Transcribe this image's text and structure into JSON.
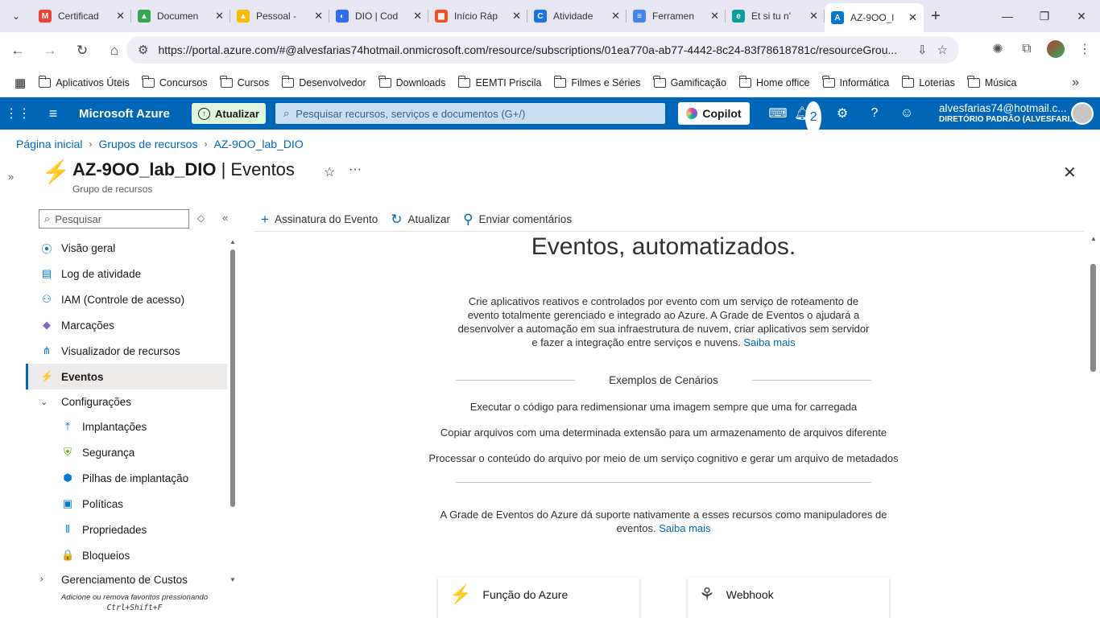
{
  "browser": {
    "tabs": [
      {
        "title": "Certificad",
        "icon": "gmail-icon",
        "color": "#ea4335",
        "glyph": "M"
      },
      {
        "title": "Documen",
        "icon": "google-drive-icon",
        "color": "#34a853",
        "glyph": "▲"
      },
      {
        "title": "Pessoal - ",
        "icon": "google-drive-icon",
        "color": "#fbbc04",
        "glyph": "▲"
      },
      {
        "title": "DIO | Cod",
        "icon": "dio-icon",
        "color": "#2e6ef5",
        "glyph": "◐"
      },
      {
        "title": "Início Ráp",
        "icon": "microsoft-icon",
        "color": "#f25022",
        "glyph": "▦"
      },
      {
        "title": "Atividade",
        "icon": "classroom-icon",
        "color": "#1a73e8",
        "glyph": "C"
      },
      {
        "title": "Ferramen",
        "icon": "docs-icon",
        "color": "#4285f4",
        "glyph": "≡"
      },
      {
        "title": "Et si tu n'",
        "icon": "edge-icon",
        "color": "#0c9e9e",
        "glyph": "e"
      },
      {
        "title": "AZ-9OO_l",
        "icon": "azure-icon",
        "color": "#0078d4",
        "glyph": "A"
      }
    ],
    "url": "https://portal.azure.com/#@alvesfarias74hotmail.onmicrosoft.com/resource/subscriptions/01ea770a-ab77-4442-8c24-83f78618781c/resourceGrou...",
    "bookmarks": [
      "Aplicativos Úteis",
      "Concursos",
      "Cursos",
      "Desenvolvedor",
      "Downloads",
      "EEMTI Priscila",
      "Filmes e Séries",
      "Gamificação",
      "Home office",
      "Informática",
      "Loterias",
      "Música"
    ]
  },
  "azure": {
    "brand": "Microsoft Azure",
    "update_label": "Atualizar",
    "search_placeholder": "Pesquisar recursos, serviços e documentos (G+/)",
    "copilot_label": "Copilot",
    "notification_count": "2",
    "account_user": "alvesfarias74@hotmail.c...",
    "account_dir": "DIRETÓRIO PADRÃO (ALVESFARI..."
  },
  "breadcrumb": [
    "Página inicial",
    "Grupos de recursos",
    "AZ-9OO_lab_DIO"
  ],
  "page": {
    "resource_name": "AZ-9OO_lab_DIO",
    "blade_name": " | Eventos",
    "subtitle": "Grupo de recursos"
  },
  "left_menu": {
    "search_placeholder": "Pesquisar",
    "items": [
      {
        "label": "Visão geral",
        "icon": "overview-icon",
        "glyph": "⦿",
        "color": "#0078d4"
      },
      {
        "label": "Log de atividade",
        "icon": "activity-log-icon",
        "glyph": "▤",
        "color": "#0078d4"
      },
      {
        "label": "IAM (Controle de acesso)",
        "icon": "iam-icon",
        "glyph": "⚇",
        "color": "#0078d4"
      },
      {
        "label": "Marcações",
        "icon": "tag-icon",
        "glyph": "◆",
        "color": "#8661c5"
      },
      {
        "label": "Visualizador de recursos",
        "icon": "resource-visualizer-icon",
        "glyph": "⋔",
        "color": "#0078d4"
      },
      {
        "label": "Eventos",
        "icon": "events-icon",
        "glyph": "⚡",
        "color": "#f4c400"
      },
      {
        "label": "Configurações",
        "icon": "chevron-down-icon",
        "glyph": "⌄",
        "color": "#323130"
      },
      {
        "label": "Implantações",
        "icon": "deployments-icon",
        "glyph": "⤒",
        "color": "#0078d4"
      },
      {
        "label": "Segurança",
        "icon": "security-icon",
        "glyph": "⛨",
        "color": "#57a300"
      },
      {
        "label": "Pilhas de implantação",
        "icon": "deployment-stacks-icon",
        "glyph": "⬢",
        "color": "#0078d4"
      },
      {
        "label": "Políticas",
        "icon": "policies-icon",
        "glyph": "▣",
        "color": "#0078d4"
      },
      {
        "label": "Propriedades",
        "icon": "properties-icon",
        "glyph": "⦀",
        "color": "#0078d4"
      },
      {
        "label": "Bloqueios",
        "icon": "locks-icon",
        "glyph": "🔒",
        "color": "#0078d4"
      },
      {
        "label": "Gerenciamento de Custos",
        "icon": "chevron-right-icon",
        "glyph": "›",
        "color": "#323130"
      }
    ],
    "favorites_hint": "Adicione ou remova favoritos pressionando",
    "favorites_shortcut": "Ctrl+Shift+F"
  },
  "toolbar": {
    "subscribe_label": "Assinatura do Evento",
    "refresh_label": "Atualizar",
    "feedback_label": "Enviar comentários"
  },
  "main": {
    "heading": "Eventos, automatizados.",
    "intro": "Crie aplicativos reativos e controlados por evento com um serviço de roteamento de evento totalmente gerenciado e integrado ao Azure. A Grade de Eventos o ajudará a desenvolver a automação em sua infraestrutura de nuvem, criar aplicativos sem servidor e fazer a integração entre serviços e nuvens.",
    "learn_more": "Saiba mais",
    "scenarios_heading": "Exemplos de Cenários",
    "scenarios": [
      "Executar o código para redimensionar uma imagem sempre que uma for carregada",
      "Copiar arquivos com uma determinada extensão para um armazenamento de arquivos diferente",
      "Processar o conteúdo do arquivo por meio de um serviço cognitivo e gerar um arquivo de metadados"
    ],
    "support_text": "A Grade de Eventos do Azure dá suporte nativamente a esses recursos como manipuladores de eventos.",
    "support_link": "Saiba mais",
    "cards": [
      {
        "label": "Função do Azure",
        "icon": "azure-function-icon"
      },
      {
        "label": "Webhook",
        "icon": "webhook-icon"
      }
    ]
  }
}
